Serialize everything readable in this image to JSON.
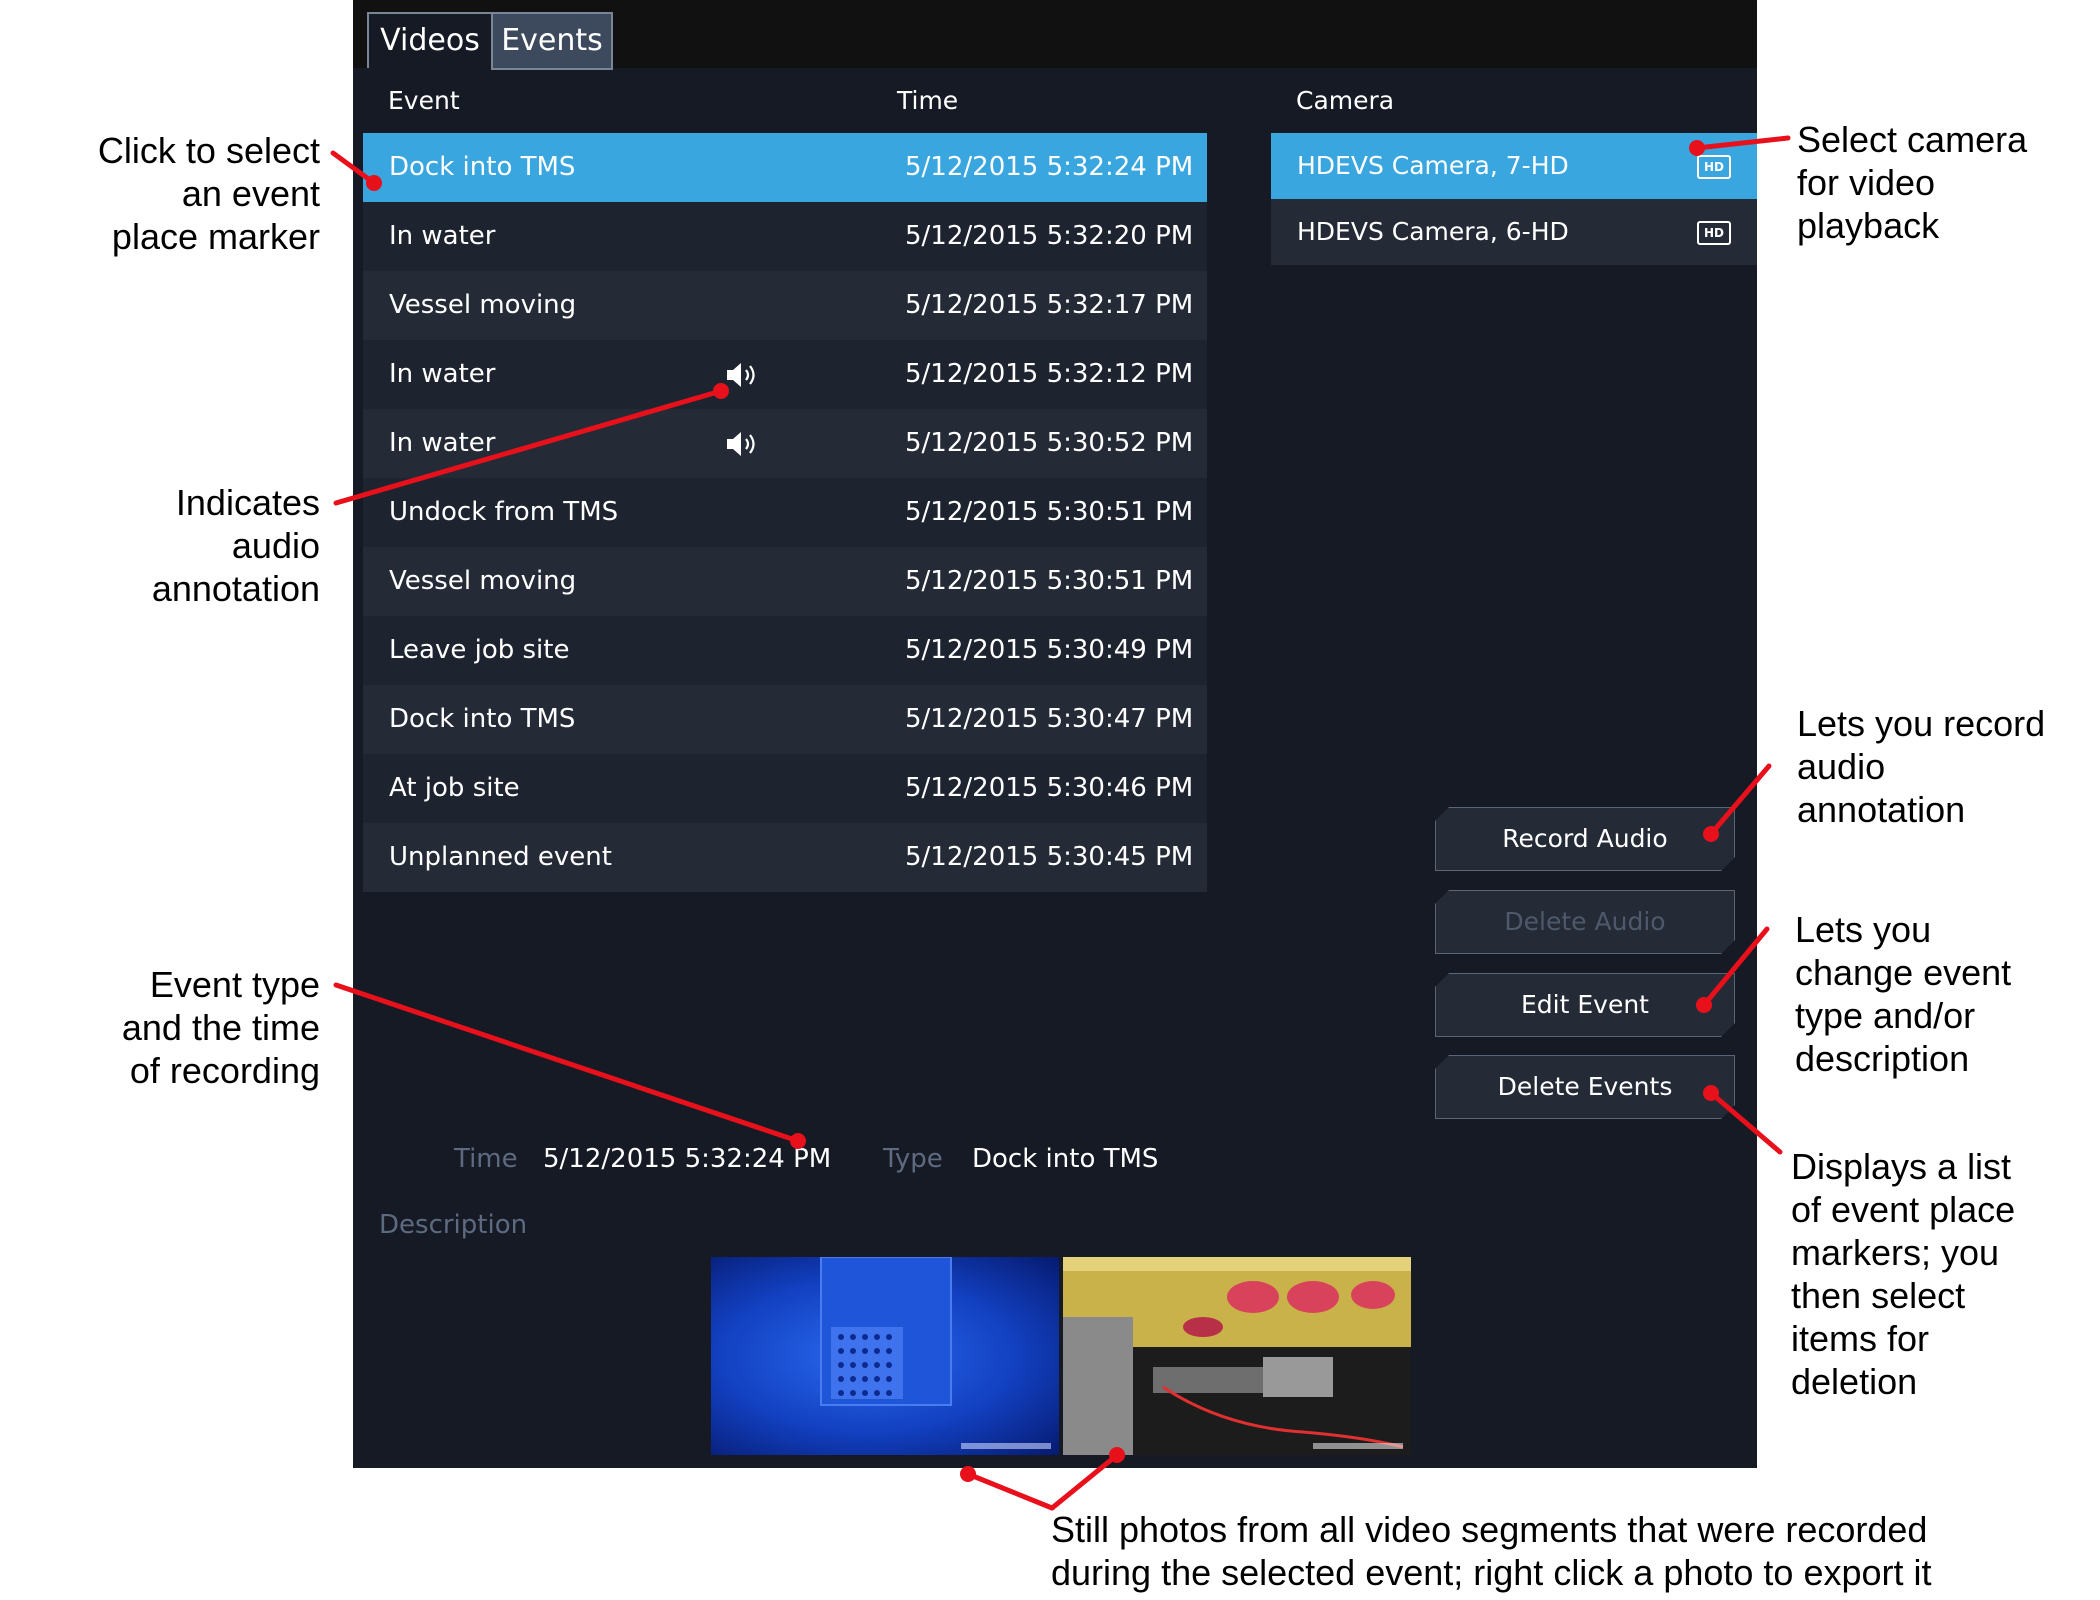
{
  "tabs": [
    "Videos",
    "Events"
  ],
  "columns": {
    "event": "Event",
    "time": "Time",
    "camera": "Camera"
  },
  "events": [
    {
      "name": "Dock into TMS",
      "time": "5/12/2015 5:32:24 PM"
    },
    {
      "name": "In water",
      "time": "5/12/2015 5:32:20 PM"
    },
    {
      "name": "Vessel moving",
      "time": "5/12/2015 5:32:17 PM"
    },
    {
      "name": "In water",
      "time": "5/12/2015 5:32:12 PM"
    },
    {
      "name": "In water",
      "time": "5/12/2015 5:30:52 PM"
    },
    {
      "name": "Undock from TMS",
      "time": "5/12/2015 5:30:51 PM"
    },
    {
      "name": "Vessel moving",
      "time": "5/12/2015 5:30:51 PM"
    },
    {
      "name": "Leave job site",
      "time": "5/12/2015 5:30:49 PM"
    },
    {
      "name": "Dock into TMS",
      "time": "5/12/2015 5:30:47 PM"
    },
    {
      "name": "At job site",
      "time": "5/12/2015 5:30:46 PM"
    },
    {
      "name": "Unplanned event",
      "time": "5/12/2015 5:30:45 PM"
    }
  ],
  "cameras": [
    {
      "name": "HDEVS Camera, 7-HD",
      "badge": "HD"
    },
    {
      "name": "HDEVS Camera, 6-HD",
      "badge": "HD"
    }
  ],
  "buttons": {
    "record_audio": "Record Audio",
    "delete_audio": "Delete Audio",
    "edit_event": "Edit Event",
    "delete_events": "Delete Events"
  },
  "details": {
    "time_label": "Time",
    "time_value": "5/12/2015 5:32:24 PM",
    "type_label": "Type",
    "type_value": "Dock into TMS",
    "description_label": "Description"
  },
  "annotations": {
    "select_event": [
      "Click to select",
      "an event",
      "place marker"
    ],
    "audio_annotation": [
      "Indicates",
      "audio",
      "annotation"
    ],
    "event_type_time": [
      "Event type",
      "and the time",
      "of recording"
    ],
    "select_camera": [
      "Select camera",
      "for video",
      "playback"
    ],
    "record_audio": [
      "Lets you record",
      "audio",
      "annotation"
    ],
    "edit_event": [
      "Lets you",
      "change event",
      "type and/or",
      "description"
    ],
    "delete_events": [
      "Displays a list",
      "of event place",
      "markers; you",
      "then select",
      "items for",
      "deletion"
    ],
    "stills": [
      "Still photos from all video segments that were recorded",
      "during the selected event; right click a photo to export it"
    ]
  },
  "colors": {
    "accent": "#3aa6e0",
    "callout": "#e8101a",
    "panel": "#161a25"
  }
}
